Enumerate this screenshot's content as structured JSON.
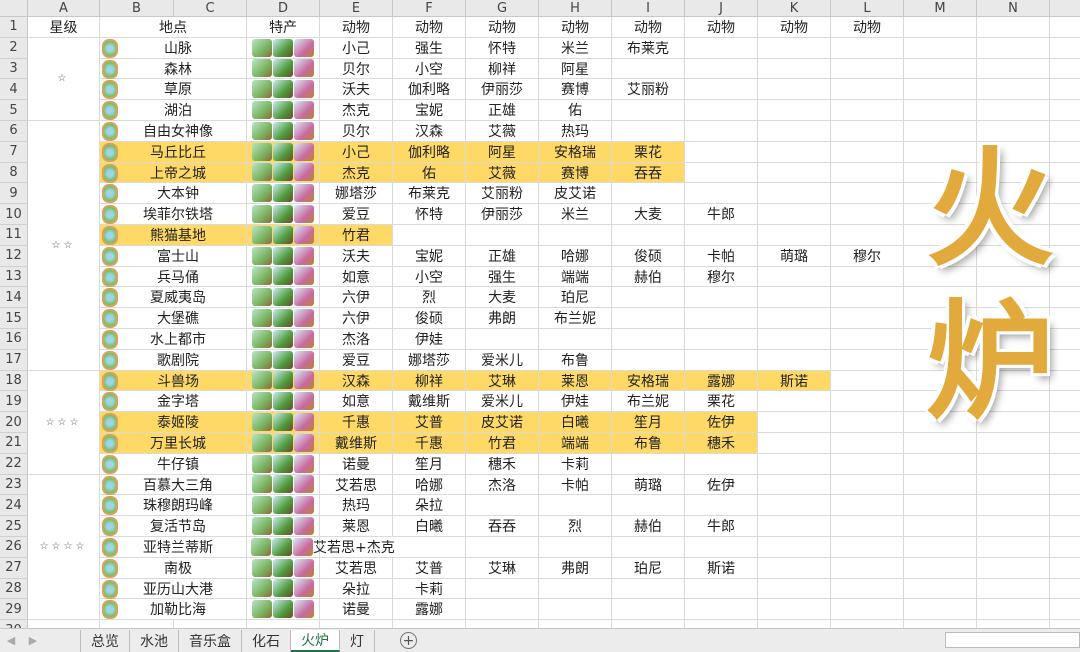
{
  "columns": [
    "A",
    "B",
    "C",
    "D",
    "E",
    "F",
    "G",
    "H",
    "I",
    "J",
    "K",
    "L",
    "M",
    "N"
  ],
  "header": {
    "stars": "星级",
    "place": "地点",
    "specialty": "特产",
    "animal": "动物"
  },
  "star_groups": [
    {
      "label": "☆",
      "from": 2,
      "to": 5
    },
    {
      "label": "☆☆",
      "from": 6,
      "to": 17
    },
    {
      "label": "☆☆☆",
      "from": 18,
      "to": 22
    },
    {
      "label": "☆☆☆☆",
      "from": 23,
      "to": 29
    }
  ],
  "rows": [
    {
      "place": "山脉",
      "animals": [
        "小己",
        "强生",
        "怀特",
        "米兰",
        "布莱克"
      ]
    },
    {
      "place": "森林",
      "animals": [
        "贝尔",
        "小空",
        "柳祥",
        "阿星"
      ]
    },
    {
      "place": "草原",
      "animals": [
        "沃夫",
        "伽利略",
        "伊丽莎",
        "赛博",
        "艾丽粉"
      ]
    },
    {
      "place": "湖泊",
      "animals": [
        "杰克",
        "宝妮",
        "正雄",
        "佑"
      ]
    },
    {
      "place": "自由女神像",
      "animals": [
        "贝尔",
        "汉森",
        "艾薇",
        "热玛"
      ]
    },
    {
      "place": "马丘比丘",
      "animals": [
        "小己",
        "伽利略",
        "阿星",
        "安格瑞",
        "栗花"
      ],
      "highlight": true
    },
    {
      "place": "上帝之城",
      "animals": [
        "杰克",
        "佑",
        "艾薇",
        "赛博",
        "吞吞"
      ],
      "highlight": true
    },
    {
      "place": "大本钟",
      "animals": [
        "娜塔莎",
        "布莱克",
        "艾丽粉",
        "皮艾诺"
      ]
    },
    {
      "place": "埃菲尔铁塔",
      "animals": [
        "爱豆",
        "怀特",
        "伊丽莎",
        "米兰",
        "大麦",
        "牛郎"
      ]
    },
    {
      "place": "熊猫基地",
      "animals": [
        "竹君"
      ],
      "highlight": true
    },
    {
      "place": "富士山",
      "animals": [
        "沃夫",
        "宝妮",
        "正雄",
        "哈娜",
        "俊硕",
        "卡帕",
        "萌璐",
        "穆尔"
      ]
    },
    {
      "place": "兵马俑",
      "animals": [
        "如意",
        "小空",
        "强生",
        "端端",
        "赫伯",
        "穆尔"
      ]
    },
    {
      "place": "夏威夷岛",
      "animals": [
        "六伊",
        "烈",
        "大麦",
        "珀尼"
      ]
    },
    {
      "place": "大堡礁",
      "animals": [
        "六伊",
        "俊硕",
        "弗朗",
        "布兰妮"
      ]
    },
    {
      "place": "水上都市",
      "animals": [
        "杰洛",
        "伊娃"
      ]
    },
    {
      "place": "歌剧院",
      "animals": [
        "爱豆",
        "娜塔莎",
        "爱米儿",
        "布鲁"
      ]
    },
    {
      "place": "斗兽场",
      "animals": [
        "汉森",
        "柳祥",
        "艾琳",
        "莱恩",
        "安格瑞",
        "露娜",
        "斯诺"
      ],
      "highlight": true
    },
    {
      "place": "金字塔",
      "animals": [
        "如意",
        "戴维斯",
        "爱米儿",
        "伊娃",
        "布兰妮",
        "栗花"
      ]
    },
    {
      "place": "泰姬陵",
      "animals": [
        "千惠",
        "艾普",
        "皮艾诺",
        "白曦",
        "笙月",
        "佐伊"
      ],
      "highlight": true
    },
    {
      "place": "万里长城",
      "animals": [
        "戴维斯",
        "千惠",
        "竹君",
        "端端",
        "布鲁",
        "穗禾"
      ],
      "highlight": true
    },
    {
      "place": "牛仔镇",
      "animals": [
        "诺曼",
        "笙月",
        "穗禾",
        "卡莉"
      ]
    },
    {
      "place": "百慕大三角",
      "animals": [
        "艾若思",
        "哈娜",
        "杰洛",
        "卡帕",
        "萌璐",
        "佐伊"
      ]
    },
    {
      "place": "珠穆朗玛峰",
      "animals": [
        "热玛",
        "朵拉"
      ]
    },
    {
      "place": "复活节岛",
      "animals": [
        "莱恩",
        "白曦",
        "吞吞",
        "烈",
        "赫伯",
        "牛郎"
      ]
    },
    {
      "place": "亚特兰蒂斯",
      "animals": [],
      "note": "艾若思+杰克"
    },
    {
      "place": "南极",
      "animals": [
        "艾若思",
        "艾普",
        "艾琳",
        "弗朗",
        "珀尼",
        "斯诺"
      ]
    },
    {
      "place": "亚历山大港",
      "animals": [
        "朵拉",
        "卡莉"
      ]
    },
    {
      "place": "加勒比海",
      "animals": [
        "诺曼",
        "露娜"
      ]
    }
  ],
  "overlay_title": [
    "火",
    "炉"
  ],
  "tabs": [
    {
      "label": "总览"
    },
    {
      "label": "水池"
    },
    {
      "label": "音乐盒"
    },
    {
      "label": "化石"
    },
    {
      "label": "火炉",
      "active": true
    },
    {
      "label": "灯"
    }
  ],
  "colors": {
    "highlight": "#FFD966",
    "title": "#E2A93C",
    "active_tab": "#217346"
  }
}
